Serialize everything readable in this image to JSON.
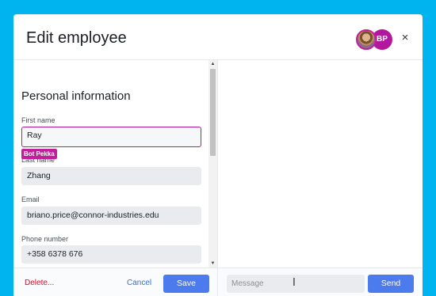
{
  "header": {
    "title": "Edit employee",
    "avatar_initials": "BP",
    "close_glyph": "×"
  },
  "form": {
    "section_title": "Personal information",
    "fields": [
      {
        "label": "First name",
        "value": "Ray",
        "focused": true
      },
      {
        "label": "Last name",
        "value": "Zhang"
      },
      {
        "label": "Email",
        "value": "briano.price@connor-industries.edu"
      },
      {
        "label": "Phone number",
        "value": "+358 6378  676"
      }
    ],
    "presence_tag": "Bot Pekka"
  },
  "footer": {
    "delete_label": "Delete...",
    "cancel_label": "Cancel",
    "save_label": "Save"
  },
  "chat": {
    "message_placeholder": "Message",
    "send_label": "Send"
  },
  "colors": {
    "background": "#00b4f0",
    "accent": "#4b7bec",
    "presence": "#b3179e",
    "danger": "#c8102e"
  },
  "icons": {
    "close": "close-icon",
    "scroll_up": "scroll-up-arrow-icon",
    "scroll_down": "scroll-down-arrow-icon",
    "text_cursor": "text-cursor-icon"
  }
}
